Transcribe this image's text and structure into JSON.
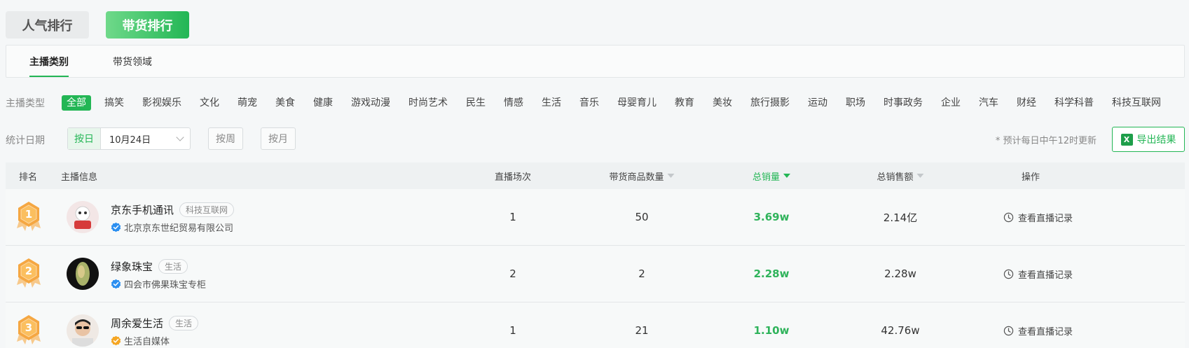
{
  "rank_tabs": [
    {
      "label": "人气排行",
      "active": false
    },
    {
      "label": "带货排行",
      "active": true
    }
  ],
  "category_tabs": [
    {
      "label": "主播类别",
      "active": true
    },
    {
      "label": "带货领域",
      "active": false
    }
  ],
  "filter": {
    "label": "主播类型",
    "items": [
      "全部",
      "搞笑",
      "影视娱乐",
      "文化",
      "萌宠",
      "美食",
      "健康",
      "游戏动漫",
      "时尚艺术",
      "民生",
      "情感",
      "生活",
      "音乐",
      "母婴育儿",
      "教育",
      "美妆",
      "旅行摄影",
      "运动",
      "职场",
      "时事政务",
      "企业",
      "汽车",
      "财经",
      "科学科普",
      "科技互联网"
    ],
    "active_index": 0
  },
  "date": {
    "label": "统计日期",
    "day_label": "按日",
    "date_value": "10月24日",
    "week_label": "按周",
    "month_label": "按月",
    "note": "* 预计每日中午12时更新",
    "export_label": "导出结果"
  },
  "table": {
    "headers": {
      "rank": "排名",
      "info": "主播信息",
      "sessions": "直播场次",
      "goods": "带货商品数量",
      "sales": "总销量",
      "revenue": "总销售额",
      "action": "操作"
    },
    "rows": [
      {
        "rank": "1",
        "name": "京东手机通讯",
        "tag": "科技互联网",
        "company": "北京京东世纪贸易有限公司",
        "verify_color": "#2b8ff0",
        "sessions": "1",
        "goods": "50",
        "sales": "3.69w",
        "revenue": "2.14亿",
        "action": "查看直播记录"
      },
      {
        "rank": "2",
        "name": "绿象珠宝",
        "tag": "生活",
        "company": "四会市佛果珠宝专柜",
        "verify_color": "#2b8ff0",
        "sessions": "2",
        "goods": "2",
        "sales": "2.28w",
        "revenue": "2.28w",
        "action": "查看直播记录"
      },
      {
        "rank": "3",
        "name": "周余爱生活",
        "tag": "生活",
        "company": "生活自媒体",
        "verify_color": "#f5a623",
        "sessions": "1",
        "goods": "21",
        "sales": "1.10w",
        "revenue": "42.76w",
        "action": "查看直播记录"
      }
    ]
  },
  "colors": {
    "accent": "#23b655",
    "medal": "#f5a742"
  }
}
